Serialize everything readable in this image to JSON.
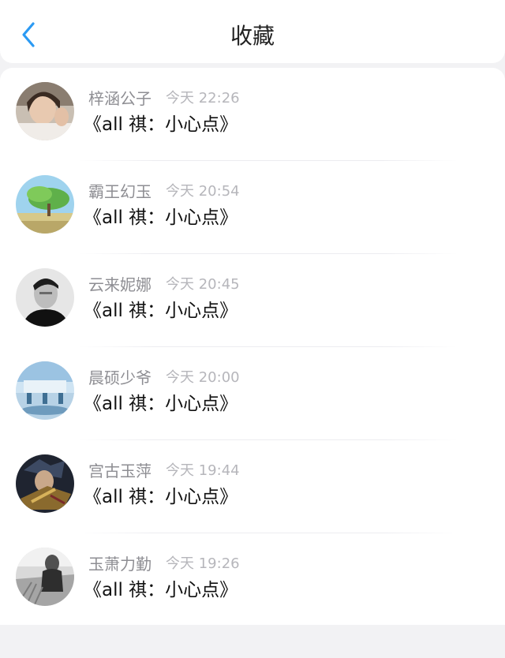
{
  "header": {
    "title": "收藏",
    "back_icon": "chevron-left-icon",
    "accent_color": "#2b9af3"
  },
  "items": [
    {
      "name": "梓涵公子",
      "time": "今天 22:26",
      "content": "《all 祺：小心点》",
      "avatar_icon": "avatar-photo-girl-icon"
    },
    {
      "name": "霸王幻玉",
      "time": "今天 20:54",
      "content": "《all 祺：小心点》",
      "avatar_icon": "avatar-landscape-tree-icon"
    },
    {
      "name": "云来妮娜",
      "time": "今天 20:45",
      "content": "《all 祺：小心点》",
      "avatar_icon": "avatar-portrait-bw-icon"
    },
    {
      "name": "晨硕少爷",
      "time": "今天 20:00",
      "content": "《all 祺：小心点》",
      "avatar_icon": "avatar-winter-scene-icon"
    },
    {
      "name": "宫古玉萍",
      "time": "今天 19:44",
      "content": "《all 祺：小心点》",
      "avatar_icon": "avatar-anime-warrior-icon"
    },
    {
      "name": "玉萧力勤",
      "time": "今天 19:26",
      "content": "《all 祺：小心点》",
      "avatar_icon": "avatar-field-bw-icon"
    }
  ]
}
